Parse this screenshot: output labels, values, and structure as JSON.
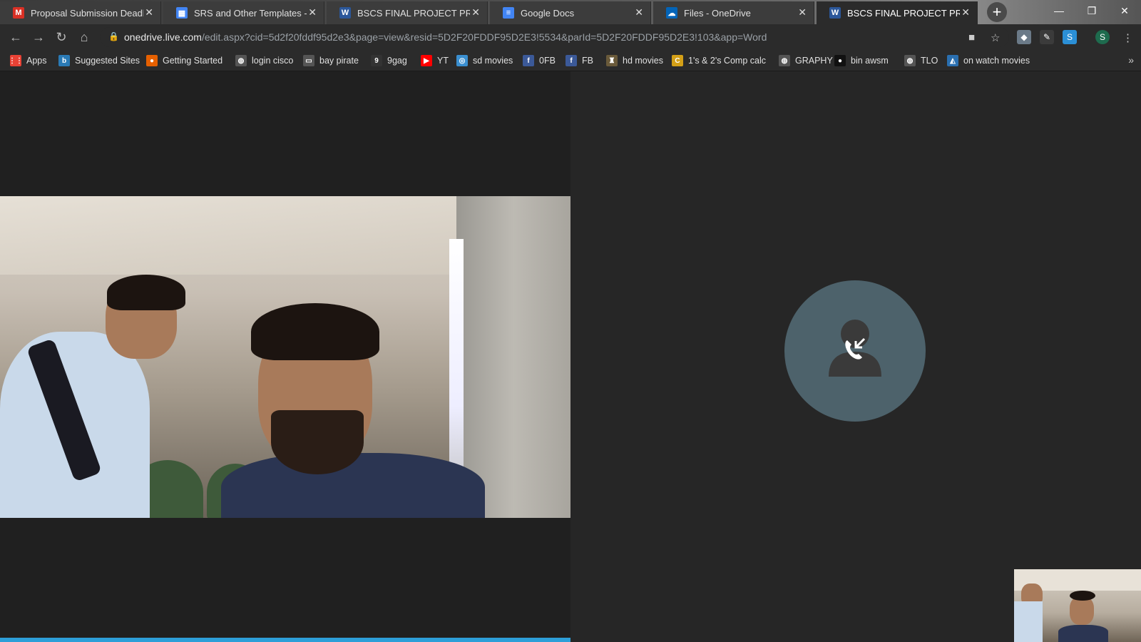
{
  "tabs": [
    {
      "title": "Proposal Submission Deadline",
      "icon": "gmail-icon",
      "color": "#d93025",
      "glyph": "M"
    },
    {
      "title": "SRS and Other Templates - FIT",
      "icon": "google-sites-icon",
      "color": "#4285f4",
      "glyph": "▦"
    },
    {
      "title": "BSCS FINAL PROJECT PROPOSAL",
      "icon": "word-icon",
      "color": "#2b579a",
      "glyph": "W"
    },
    {
      "title": "Google Docs",
      "icon": "google-docs-icon",
      "color": "#4285f4",
      "glyph": "≡"
    },
    {
      "title": "Files - OneDrive",
      "icon": "onedrive-icon",
      "color": "#0364b8",
      "glyph": "☁"
    },
    {
      "title": "BSCS FINAL PROJECT PROPOSAL",
      "icon": "word-icon",
      "color": "#2b579a",
      "glyph": "W",
      "active": true
    }
  ],
  "window_controls": {
    "minimize": "—",
    "restore": "❐",
    "close": "✕"
  },
  "address": {
    "host": "onedrive.live.com",
    "path": "/edit.aspx?cid=5d2f20fddf95d2e3&page=view&resid=5D2F20FDDF95D2E3!5534&parId=5D2F20FDDF95D2E3!103&app=Word"
  },
  "profile_initial": "S",
  "bookmarks": [
    {
      "label": "Apps",
      "icon": "apps-grid-icon",
      "color": "#e94235",
      "glyph": "⋮⋮"
    },
    {
      "label": "Suggested Sites",
      "icon": "bing-icon",
      "color": "#2a7ab5",
      "glyph": "b"
    },
    {
      "label": "Getting Started",
      "icon": "firefox-icon",
      "color": "#e66000",
      "glyph": "●"
    },
    {
      "label": "login cisco",
      "icon": "globe-icon",
      "color": "#555555",
      "glyph": "◍"
    },
    {
      "label": "bay pirate",
      "icon": "monitor-icon",
      "color": "#555555",
      "glyph": "▭"
    },
    {
      "label": "9gag",
      "icon": "9gag-icon",
      "color": "#333333",
      "glyph": "9"
    },
    {
      "label": "YT",
      "icon": "youtube-icon",
      "color": "#ff0000",
      "glyph": "▶"
    },
    {
      "label": "sd movies",
      "icon": "site-icon",
      "color": "#3a8fd0",
      "glyph": "◎"
    },
    {
      "label": "0FB",
      "icon": "facebook-icon",
      "color": "#3b5998",
      "glyph": "f"
    },
    {
      "label": "FB",
      "icon": "facebook-icon",
      "color": "#3b5998",
      "glyph": "f"
    },
    {
      "label": "hd movies",
      "icon": "site-icon",
      "color": "#6a5a3a",
      "glyph": "♜"
    },
    {
      "label": "1's & 2's Comp calc",
      "icon": "calc-icon",
      "color": "#d4a017",
      "glyph": "C"
    },
    {
      "label": "GRAPHY",
      "icon": "globe-icon",
      "color": "#555555",
      "glyph": "◍"
    },
    {
      "label": "bin awsm",
      "icon": "site-icon",
      "color": "#111111",
      "glyph": "●"
    },
    {
      "label": "TLO",
      "icon": "globe-icon",
      "color": "#555555",
      "glyph": "◍"
    },
    {
      "label": "on watch movies",
      "icon": "site-icon",
      "color": "#2a6fb0",
      "glyph": "◭"
    }
  ],
  "call": {
    "remote_status_icon": "incoming-call-icon",
    "remote_avatar_color": "#4d626b",
    "progress_color": "#2d9fd8"
  }
}
